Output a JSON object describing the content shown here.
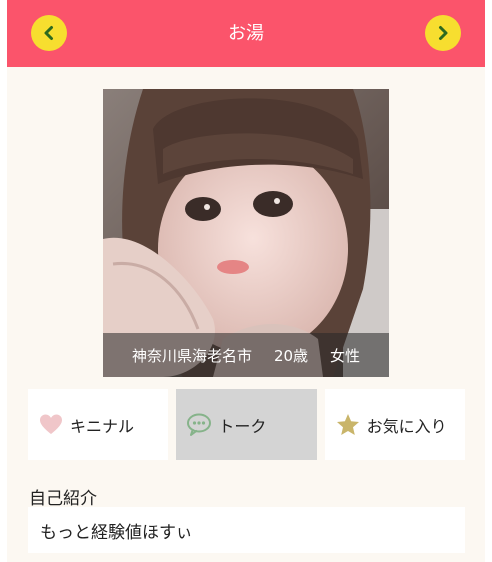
{
  "header": {
    "title": "お湯",
    "prev_icon": "chevron-left-icon",
    "next_icon": "chevron-right-icon",
    "bg_color": "#fb546b",
    "nav_color": "#f7de2f"
  },
  "profile": {
    "location": "神奈川県海老名市",
    "age": "20歳",
    "gender": "女性"
  },
  "actions": [
    {
      "label": "キニナル",
      "icon": "heart-icon"
    },
    {
      "label": "トーク",
      "icon": "chat-bubble-icon",
      "active": true
    },
    {
      "label": "お気に入り",
      "icon": "star-icon"
    }
  ],
  "intro": {
    "label": "自己紹介",
    "text": "もっと経験値ほすぃ"
  }
}
